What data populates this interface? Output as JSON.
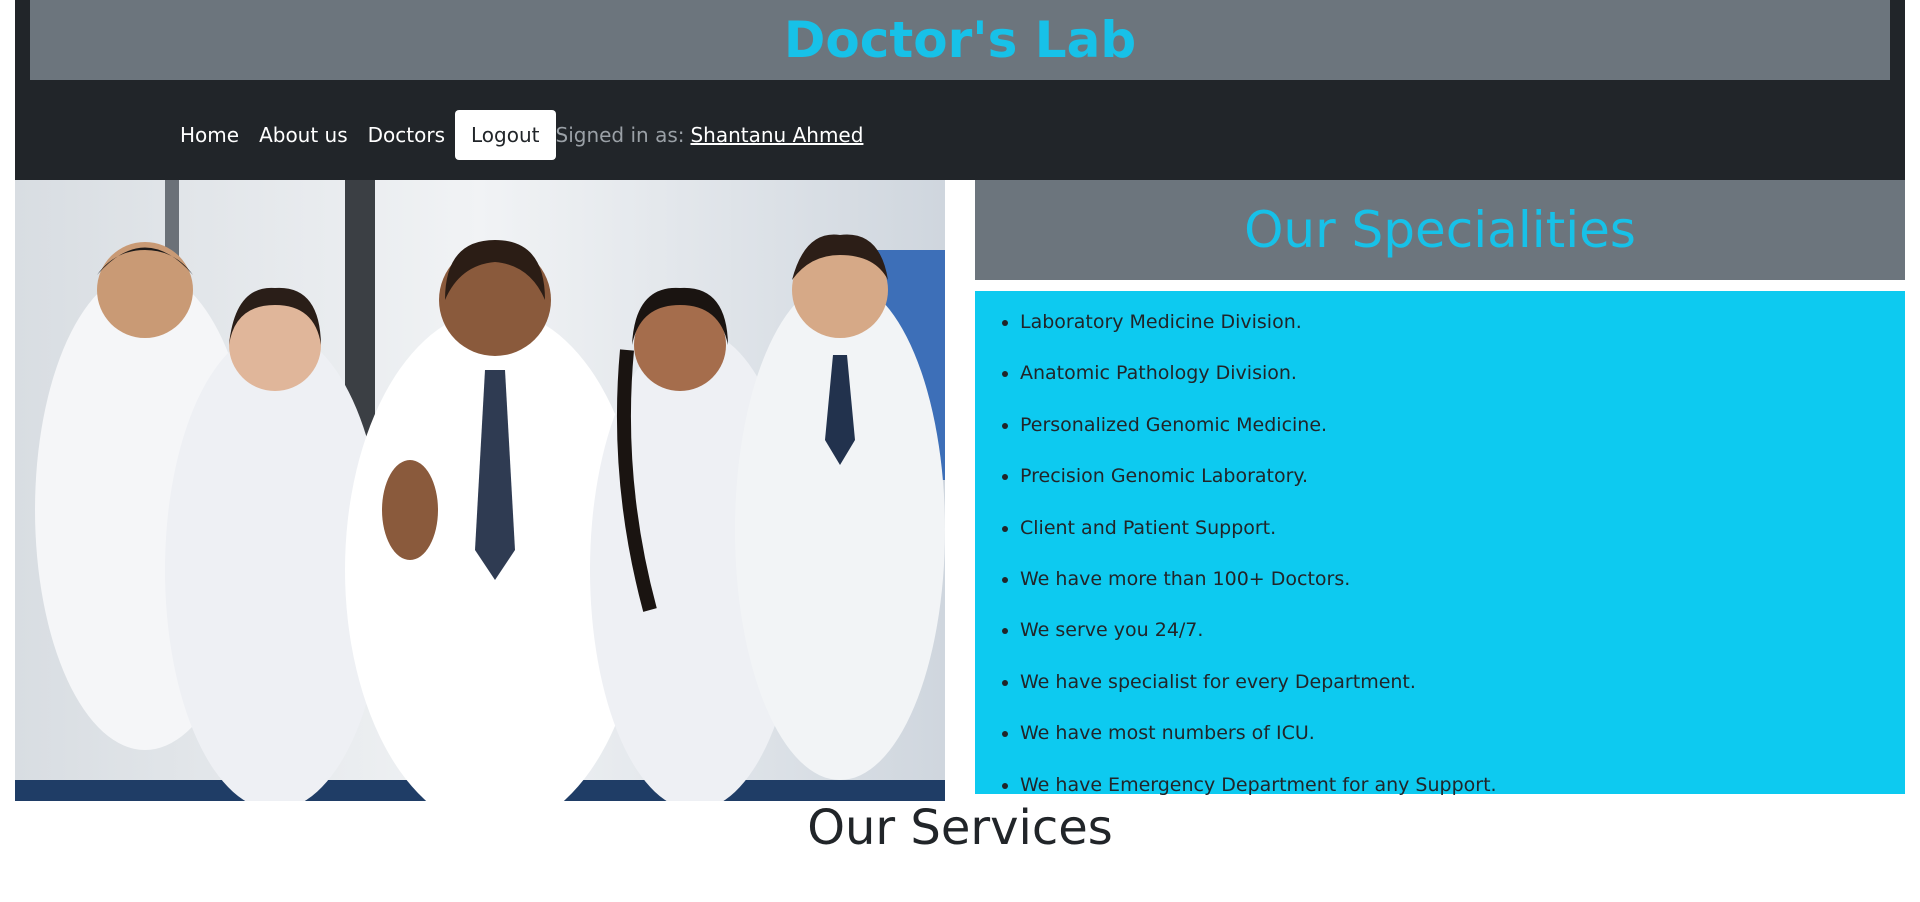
{
  "brand": {
    "title": "Doctor's Lab"
  },
  "nav": {
    "items": [
      {
        "label": "Home"
      },
      {
        "label": "About us"
      },
      {
        "label": "Doctors"
      }
    ],
    "logout_label": "Logout",
    "signed_in_label": "Signed in as:",
    "user_name": "Shantanu Ahmed"
  },
  "specialities": {
    "title": "Our Specialities",
    "items": [
      "Laboratory Medicine Division.",
      "Anatomic Pathology Division.",
      "Personalized Genomic Medicine.",
      "Precision Genomic Laboratory.",
      "Client and Patient Support.",
      "We have more than 100+ Doctors.",
      "We serve you 24/7.",
      "We have specialist for every Department.",
      "We have most numbers of ICU.",
      "We have Emergency Department for any Support."
    ]
  },
  "services": {
    "title": "Our Services"
  },
  "colors": {
    "header_bg": "#212529",
    "brand_bar_bg": "#6c757d",
    "accent": "#17c1e8",
    "list_bg": "#0dcaf0"
  }
}
